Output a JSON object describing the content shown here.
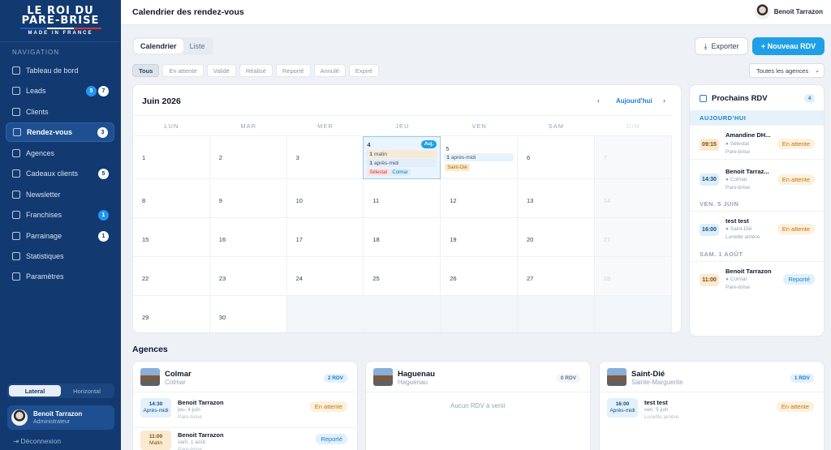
{
  "brand": {
    "line1": "LE ROI DU",
    "line2": "PARE-BRISE",
    "tagline": "MADE IN FRANCE"
  },
  "nav": {
    "section": "NAVIGATION",
    "items": [
      {
        "label": "Tableau de bord",
        "icon": "dashboard-icon"
      },
      {
        "label": "Leads",
        "icon": "leads-icon",
        "badges": [
          "5",
          "7"
        ]
      },
      {
        "label": "Clients",
        "icon": "clients-icon"
      },
      {
        "label": "Rendez-vous",
        "icon": "calendar-icon",
        "badges": [
          "3"
        ],
        "active": true
      },
      {
        "label": "Agences",
        "icon": "building-icon"
      },
      {
        "label": "Cadeaux clients",
        "icon": "gift-icon",
        "badges": [
          "5"
        ]
      },
      {
        "label": "Newsletter",
        "icon": "newsletter-icon"
      },
      {
        "label": "Franchises",
        "icon": "franchise-icon",
        "badges": [
          "1"
        ]
      },
      {
        "label": "Parrainage",
        "icon": "referral-icon",
        "badges": [
          "1"
        ]
      },
      {
        "label": "Statistiques",
        "icon": "stats-icon"
      },
      {
        "label": "Paramètres",
        "icon": "settings-icon"
      }
    ],
    "layout_options": [
      "Lateral",
      "Horizontal"
    ],
    "user": {
      "name": "Benoit Tarrazon",
      "role": "Administrateur"
    },
    "logout": "Déconnexion"
  },
  "header": {
    "title": "Calendrier des rendez-vous",
    "user": "Benoit Tarrazon"
  },
  "toolbar": {
    "views": [
      "Calendrier",
      "Liste"
    ],
    "export": "Exporter",
    "new": "+ Nouveau RDV",
    "agency_select": "Toutes les agences"
  },
  "filters": [
    "Tous",
    "En attente",
    "Validé",
    "Réalisé",
    "Reporté",
    "Annulé",
    "Expiré"
  ],
  "calendar": {
    "month": "Juin 2026",
    "today_label": "Aujourd'hui",
    "prev": "‹",
    "next": "›",
    "weekdays": [
      "LUN",
      "MAR",
      "MER",
      "JEU",
      "VEN",
      "SAM",
      "DIM"
    ],
    "weeks": [
      [
        "1",
        "2",
        "3",
        "4",
        "5",
        "6",
        "7"
      ],
      [
        "8",
        "9",
        "10",
        "11",
        "12",
        "13",
        "14"
      ],
      [
        "15",
        "16",
        "17",
        "18",
        "19",
        "20",
        "21"
      ],
      [
        "22",
        "23",
        "24",
        "25",
        "26",
        "27",
        "28"
      ],
      [
        "29",
        "30",
        "",
        "",
        "",
        "",
        ""
      ]
    ],
    "today_badge": "Auj.",
    "day4_events": [
      {
        "count": "1",
        "label": "matin"
      },
      {
        "count": "1",
        "label": "après-midi"
      }
    ],
    "day4_tags": [
      "Sélestat",
      "Colmar"
    ],
    "day5_events": [
      {
        "count": "1",
        "label": "après-midi"
      }
    ],
    "day5_tags": [
      "Saint-Dié"
    ]
  },
  "next_rdv": {
    "title": "Prochains RDV",
    "count": "4",
    "groups": [
      {
        "label": "AUJOURD'HUI",
        "items": [
          {
            "time": "09:15",
            "name": "Amandine DH...",
            "loc": "Sélestat",
            "type": "Pare-brise",
            "status": "En attente"
          },
          {
            "time": "14:30",
            "name": "Benoit Tarraz...",
            "loc": "Colmar",
            "type": "Pare-brise",
            "status": "En attente"
          }
        ]
      },
      {
        "label": "VEN. 5 JUIN",
        "items": [
          {
            "time": "16:00",
            "name": "test test",
            "loc": "Saint-Dié",
            "type": "Lunette arrière",
            "status": "En attente"
          }
        ]
      },
      {
        "label": "SAM. 1 AOÛT",
        "items": [
          {
            "time": "11:00",
            "name": "Benoit Tarrazon",
            "loc": "Colmar",
            "type": "Pare-brise",
            "status": "Reporté"
          }
        ]
      }
    ]
  },
  "agences": {
    "title": "Agences",
    "cards": [
      {
        "name": "Colmar",
        "city": "Colmar",
        "count": "2 RDV",
        "rows": [
          {
            "time": "14:30",
            "period": "Après-midi",
            "name": "Benoit Tarrazon",
            "date": "jeu. 4 juin",
            "type": "Pare-brise",
            "status": "En attente"
          },
          {
            "time": "11:00",
            "period": "Matin",
            "name": "Benoit Tarrazon",
            "date": "sam. 1 août",
            "type": "Pare-brise",
            "status": "Reporté"
          }
        ]
      },
      {
        "name": "Haguenau",
        "city": "Haguenau",
        "count": "0 RDV",
        "empty": "Aucun RDV à venir"
      },
      {
        "name": "Saint-Dié",
        "city": "Sainte-Marguerite",
        "count": "1 RDV",
        "rows": [
          {
            "time": "16:00",
            "period": "Après-midi",
            "name": "test test",
            "date": "ven. 5 juin",
            "type": "Lunette arrière",
            "status": "En attente"
          }
        ]
      }
    ]
  }
}
